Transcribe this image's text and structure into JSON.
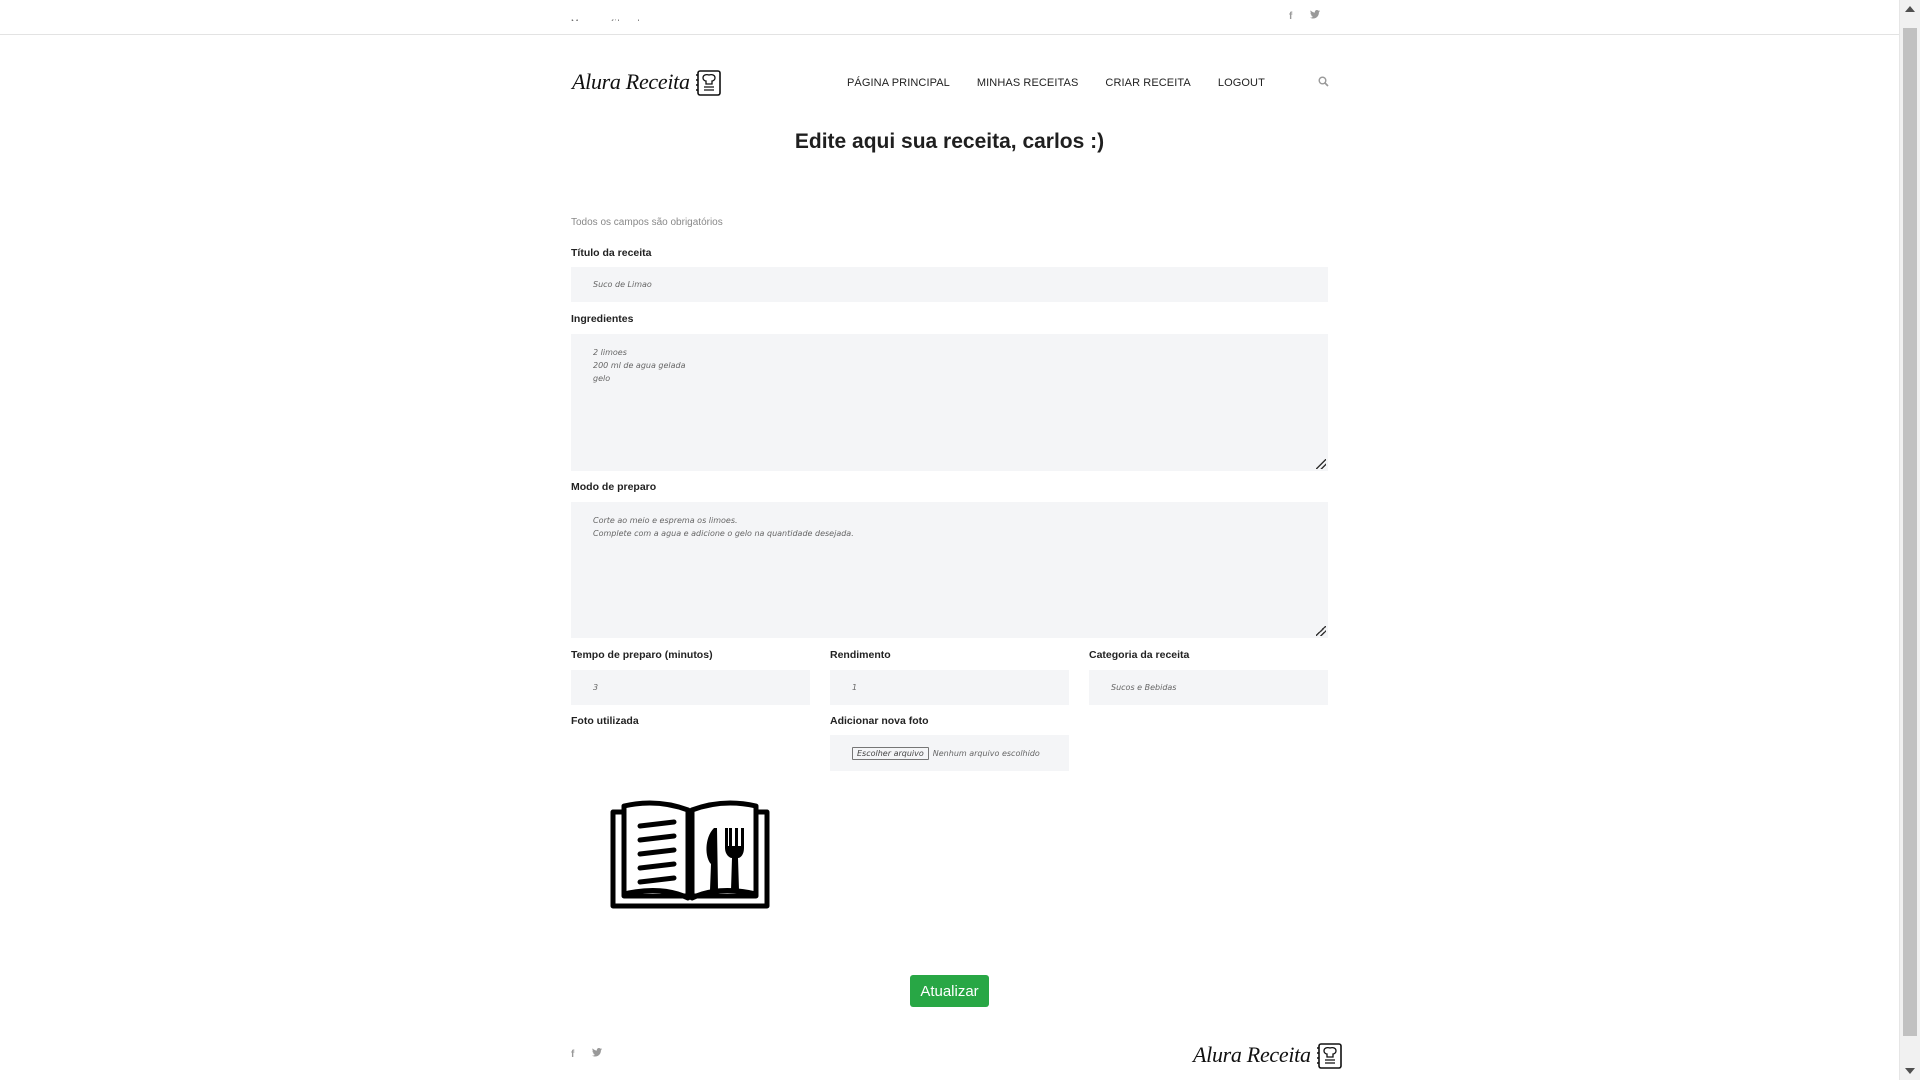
{
  "header": {
    "top_text": "Meu perfil · ola",
    "social": [
      "facebook-icon",
      "twitter-icon"
    ],
    "logo_text": "Alura Receita",
    "nav": [
      "PÁGINA PRINCIPAL",
      "MINHAS RECEITAS",
      "CRIAR RECEITA",
      "LOGOUT"
    ]
  },
  "page": {
    "title": "Edite aqui sua receita, carlos :)",
    "note": "Todos os campos são obrigatórios"
  },
  "form": {
    "title_label": "Título da receita",
    "title_value": "Suco de Limao",
    "ingredients_label": "Ingredientes",
    "ingredients_value": "2 limoes\n200 ml de agua gelada\ngelo",
    "method_label": "Modo de preparo",
    "method_value": "Corte ao meio e esprema os limoes.\nComplete com a agua e adicione o gelo na quantidade desejada.",
    "time_label": "Tempo de preparo (minutos)",
    "time_value": "3",
    "yield_label": "Rendimento",
    "yield_value": "1",
    "category_label": "Categoria da receita",
    "category_value": "Sucos e Bebidas",
    "photo_label": "Foto utilizada",
    "new_photo_label": "Adicionar nova foto",
    "file_button": "Escolher arquivo",
    "file_status": "Nenhum arquivo escolhido",
    "submit": "Atualizar"
  },
  "footer": {
    "logo_text": "Alura Receita",
    "social": [
      "facebook-icon",
      "twitter-icon"
    ]
  },
  "colors": {
    "submit_bg": "#28a745",
    "field_bg": "#f4f5f7",
    "text": "#222222"
  }
}
